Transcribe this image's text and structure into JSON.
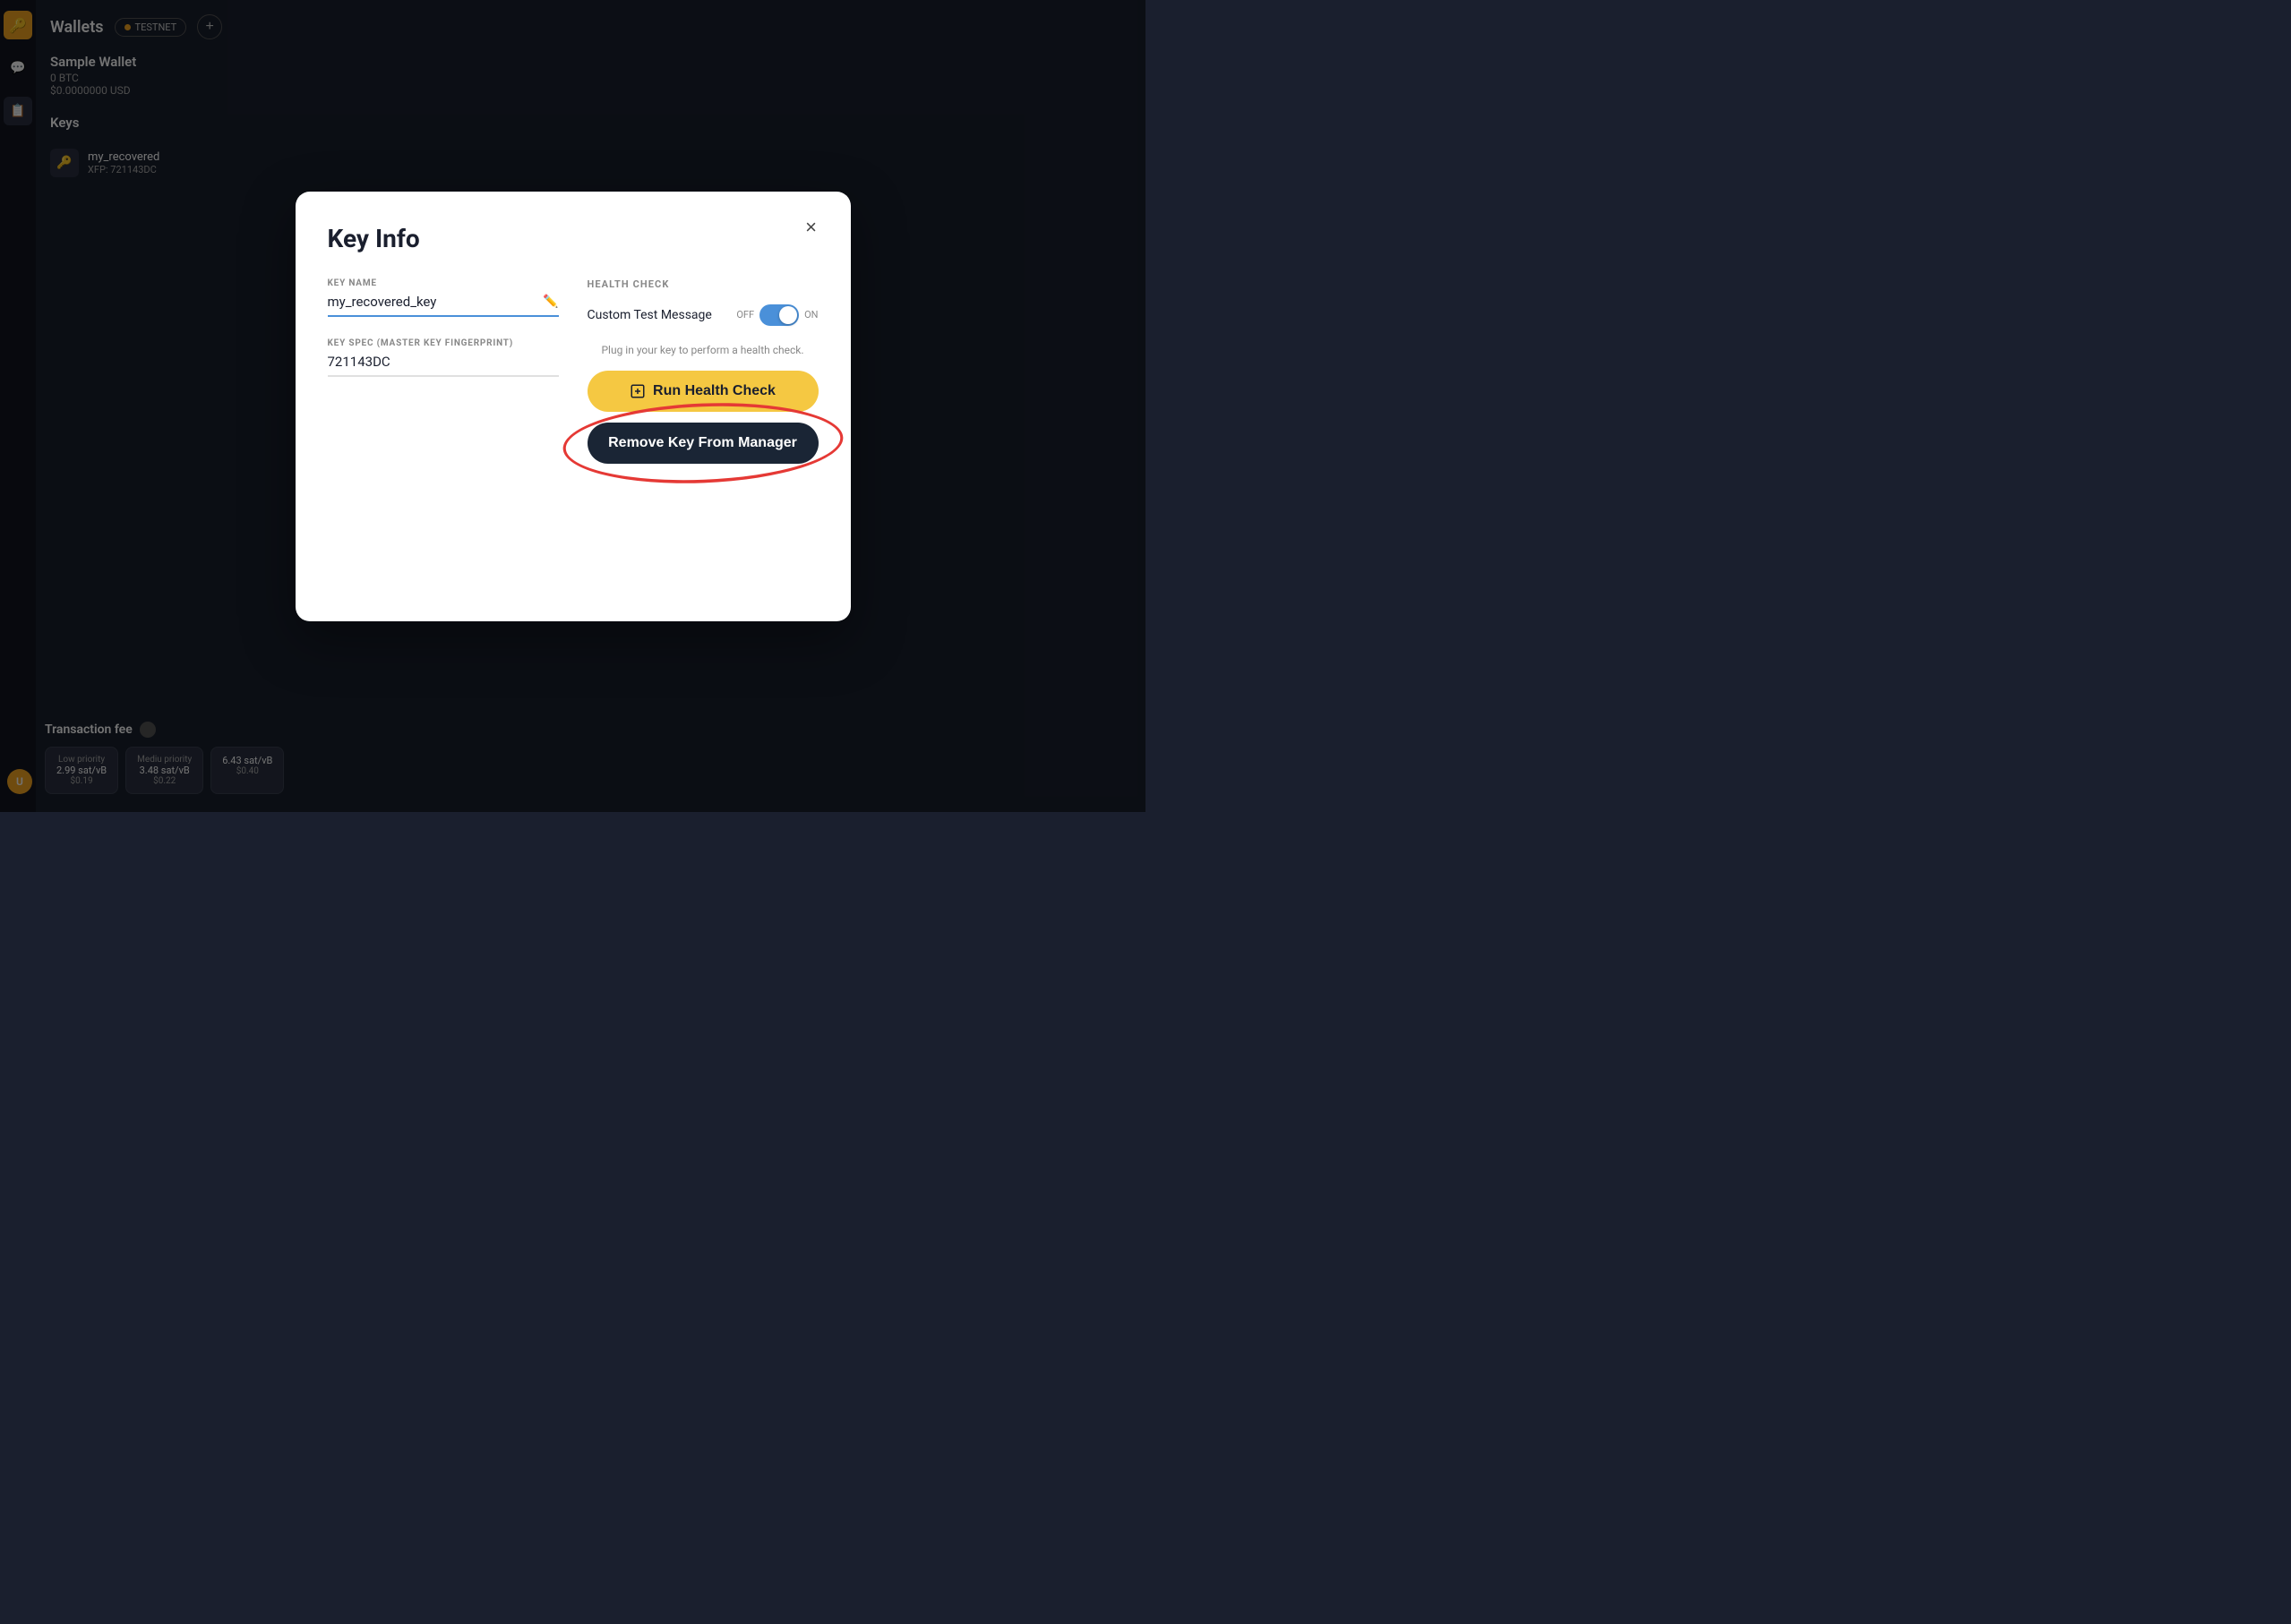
{
  "app": {
    "title": "Wallets",
    "network": "TESTNET",
    "add_button": "+"
  },
  "wallet": {
    "name": "Sample Wallet",
    "balance_btc": "0 BTC",
    "balance_usd": "$0.0000000 USD"
  },
  "keys_section": {
    "title": "Keys",
    "items": [
      {
        "name": "my_recovered",
        "xfp": "XFP: 721143DC"
      }
    ]
  },
  "transaction_fee": {
    "title": "Transaction fee",
    "options": [
      {
        "priority": "Low priority",
        "rate": "2.99 sat/vB",
        "usd": "$0.19"
      },
      {
        "priority": "Mediu priority",
        "rate": "3.48 sat/vB",
        "usd": "$0.22"
      },
      {
        "priority": "",
        "rate": "6.43 sat/vB",
        "usd": "$0.40"
      }
    ]
  },
  "user": {
    "avatar_letter": "U"
  },
  "modal": {
    "title": "Key Info",
    "close_label": "×",
    "key_name_label": "KEY NAME",
    "key_name_value": "my_recovered_key",
    "key_spec_label": "KEY SPEC (MASTER KEY FINGERPRINT)",
    "key_spec_value": "721143DC",
    "health_check_label": "HEALTH CHECK",
    "custom_test_message_label": "Custom Test Message",
    "toggle_off": "OFF",
    "toggle_on": "ON",
    "health_hint": "Plug in your key to perform a health check.",
    "run_health_check_label": "Run Health Check",
    "remove_key_label": "Remove Key From Manager"
  }
}
